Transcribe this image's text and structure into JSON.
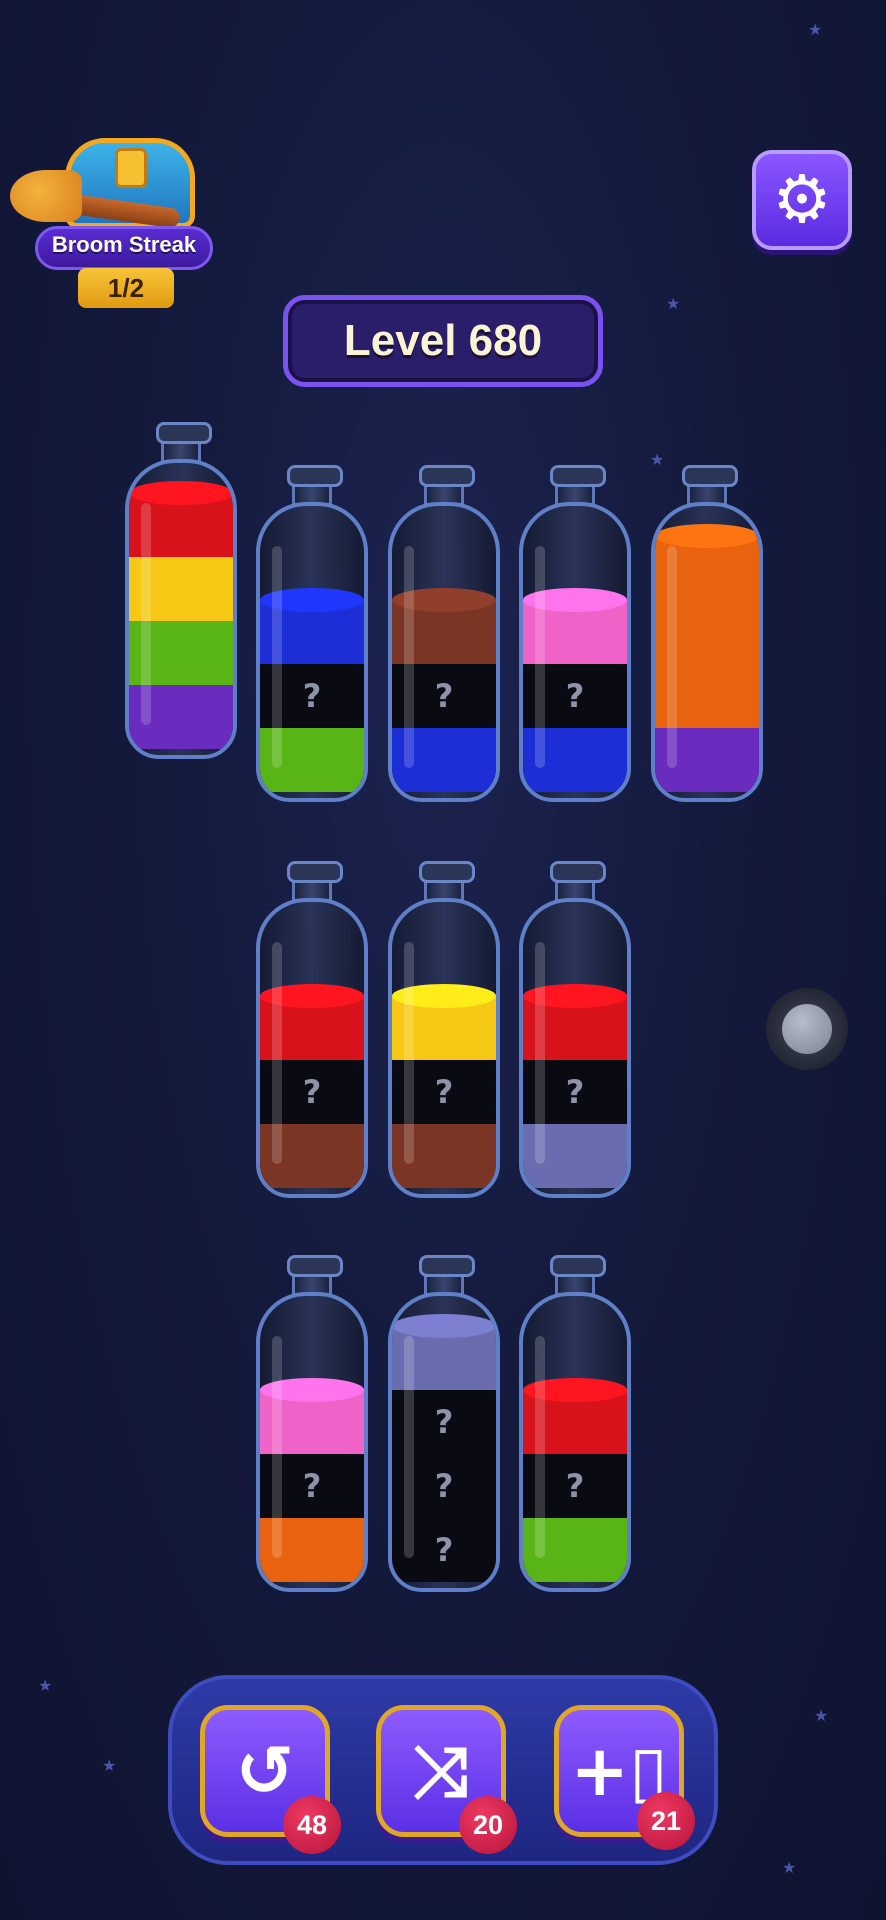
{
  "streak": {
    "label": "Broom Streak",
    "count": "1/2"
  },
  "settings": {
    "icon": "gear-icon"
  },
  "level": {
    "title": "Level 680"
  },
  "colors": {
    "red": "#d8121b",
    "yellow": "#f6c815",
    "green": "#59b516",
    "purple": "#6a2bbf",
    "blue": "#1c2ed6",
    "brown": "#7a3524",
    "pink": "#ef62c8",
    "orange": "#e8620f",
    "lavender": "#6a6cb0",
    "hidden": "#0a0b12"
  },
  "bottles": [
    {
      "layers": [
        "purple",
        "green",
        "yellow",
        "red"
      ]
    },
    {
      "layers": [
        "green",
        "hidden",
        "blue"
      ]
    },
    {
      "layers": [
        "blue",
        "hidden",
        "brown"
      ]
    },
    {
      "layers": [
        "blue",
        "hidden",
        "pink"
      ]
    },
    {
      "layers": [
        "purple",
        "orange",
        "orange",
        "orange"
      ]
    },
    {
      "layers": [
        "brown",
        "hidden",
        "red"
      ]
    },
    {
      "layers": [
        "brown",
        "hidden",
        "yellow"
      ]
    },
    {
      "layers": [
        "lavender",
        "hidden",
        "red"
      ]
    },
    {
      "layers": [
        "orange",
        "hidden",
        "pink"
      ]
    },
    {
      "layers": [
        "hidden",
        "hidden",
        "hidden",
        "lavender"
      ]
    },
    {
      "layers": [
        "green",
        "hidden",
        "red"
      ]
    }
  ],
  "hidden_mark": "?",
  "powerups": [
    {
      "icon": "undo-icon",
      "glyph": "↺",
      "count": "48"
    },
    {
      "icon": "shuffle-icon",
      "glyph": "⤨",
      "count": "20"
    },
    {
      "icon": "add-bottle-icon",
      "glyph": "+▯",
      "count": "21"
    }
  ]
}
